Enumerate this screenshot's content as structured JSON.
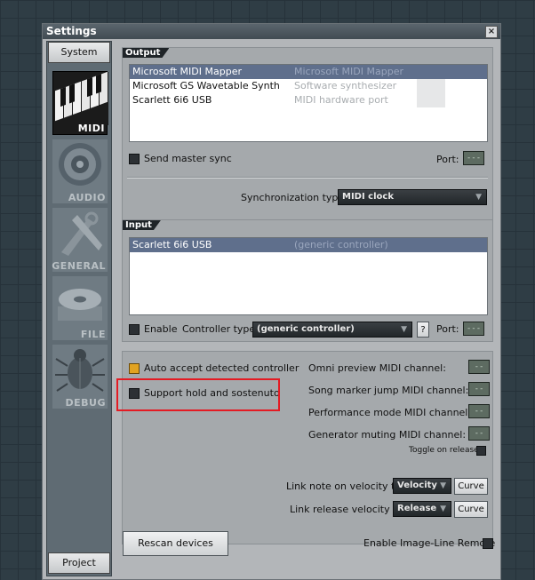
{
  "window": {
    "title": "Settings",
    "close": "×"
  },
  "sidebar": {
    "top_button": "System",
    "bottom_button": "Project",
    "categories": [
      {
        "label": "MIDI"
      },
      {
        "label": "AUDIO"
      },
      {
        "label": "GENERAL"
      },
      {
        "label": "FILE"
      },
      {
        "label": "DEBUG"
      }
    ]
  },
  "output": {
    "title": "Output",
    "devices": [
      {
        "name": "Microsoft MIDI Mapper",
        "type": "Microsoft MIDI Mapper"
      },
      {
        "name": "Microsoft GS Wavetable Synth",
        "type": "Software synthesizer"
      },
      {
        "name": "Scarlett 6i6 USB",
        "type": "MIDI hardware port"
      }
    ],
    "send_master_sync": "Send master sync",
    "port_label": "Port:",
    "port_value": "---",
    "sync_type_label": "Synchronization type:",
    "sync_type_value": "MIDI clock"
  },
  "input": {
    "title": "Input",
    "devices": [
      {
        "name": "Scarlett 6i6 USB",
        "type": "(generic controller)"
      }
    ],
    "enable_label": "Enable",
    "controller_type_label": "Controller type:",
    "controller_type_value": "(generic controller)",
    "help": "?",
    "port_label": "Port:",
    "port_value": "---"
  },
  "options": {
    "auto_accept": "Auto accept detected controller",
    "support_hold": "Support hold and sostenuto",
    "omni_preview": "Omni preview MIDI channel:",
    "song_marker": "Song marker jump MIDI channel:",
    "performance_mode": "Performance mode MIDI channel:",
    "generator_muting": "Generator muting MIDI channel:",
    "channel_value": "--",
    "toggle_on_release": "Toggle on release",
    "link_note_on_label": "Link note on velocity to:",
    "link_note_on_value": "Velocity",
    "link_release_label": "Link release velocity to:",
    "link_release_value": "Release",
    "curve": "Curve"
  },
  "footer": {
    "rescan": "Rescan devices",
    "enable_remote": "Enable Image-Line Remote"
  }
}
